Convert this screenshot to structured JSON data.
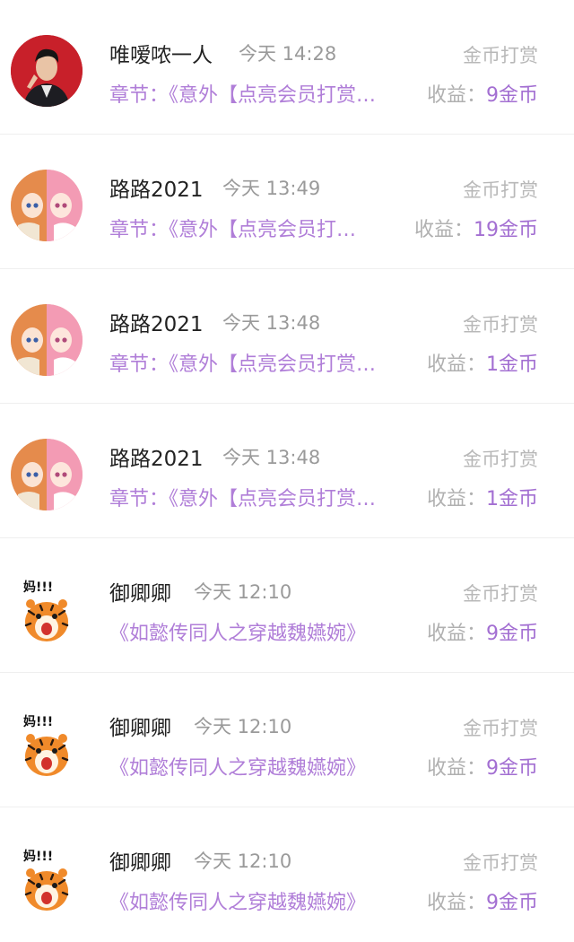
{
  "records": [
    {
      "avatar_icon": "man-in-suit-avatar",
      "name": "唯嗳哝一人",
      "time": "今天 14:28",
      "type": "金币打赏",
      "chapter": "章节：《意外【点亮会员打赏…",
      "income_label": "收益：",
      "income_value": "9金币"
    },
    {
      "avatar_icon": "anime-girls-avatar",
      "name": "路路2021",
      "time": "今天 13:49",
      "type": "金币打赏",
      "chapter": "章节：《意外【点亮会员打…",
      "income_label": "收益：",
      "income_value": "19金币"
    },
    {
      "avatar_icon": "anime-girls-avatar",
      "name": "路路2021",
      "time": "今天 13:48",
      "type": "金币打赏",
      "chapter": "章节：《意外【点亮会员打赏…",
      "income_label": "收益：",
      "income_value": "1金币"
    },
    {
      "avatar_icon": "anime-girls-avatar",
      "name": "路路2021",
      "time": "今天 13:48",
      "type": "金币打赏",
      "chapter": "章节：《意外【点亮会员打赏…",
      "income_label": "收益：",
      "income_value": "1金币"
    },
    {
      "avatar_icon": "tiger-sticker-avatar",
      "avatar_text": "妈!!!",
      "name": "御卿卿",
      "time": "今天 12:10",
      "type": "金币打赏",
      "chapter": "《如懿传同人之穿越魏嬿婉》",
      "income_label": "收益：",
      "income_value": "9金币"
    },
    {
      "avatar_icon": "tiger-sticker-avatar",
      "avatar_text": "妈!!!",
      "name": "御卿卿",
      "time": "今天 12:10",
      "type": "金币打赏",
      "chapter": "《如懿传同人之穿越魏嬿婉》",
      "income_label": "收益：",
      "income_value": "9金币"
    },
    {
      "avatar_icon": "tiger-sticker-avatar",
      "avatar_text": "妈!!!",
      "name": "御卿卿",
      "time": "今天 12:10",
      "type": "金币打赏",
      "chapter": "《如懿传同人之穿越魏嬿婉》",
      "income_label": "收益：",
      "income_value": "9金币"
    }
  ],
  "colors": {
    "chapter": "#b07ed8",
    "income_value": "#a36fd2",
    "muted": "#b8b8b8",
    "name": "#222222"
  }
}
